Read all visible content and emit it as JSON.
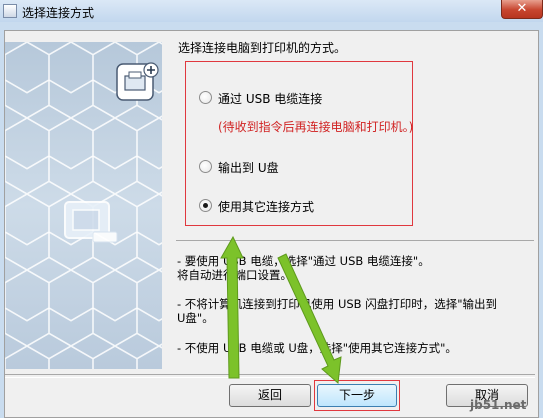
{
  "window": {
    "title": "选择连接方式",
    "close_glyph": "✕"
  },
  "main": {
    "heading": "选择连接电脑到打印机的方式。",
    "options": [
      {
        "label": "通过 USB 电缆连接",
        "checked": false
      },
      {
        "label": "输出到 U盘",
        "checked": false
      },
      {
        "label": "使用其它连接方式",
        "checked": true
      }
    ],
    "note": "(待收到指令后再连接电脑和打印机。)",
    "descriptions": [
      "- 要使用 USB 电缆，选择\"通过 USB 电缆连接\"。",
      "将自动进行端口设置。",
      "- 不将计算机连接到打印机使用 USB 闪盘打印时，选择\"输出到",
      "U盘\"。",
      "- 不使用 USB 电缆或 U盘，选择\"使用其它连接方式\"。"
    ]
  },
  "buttons": {
    "back": "返回",
    "next": "下一步",
    "cancel": "取消"
  },
  "watermark": "jb51.net",
  "colors": {
    "highlight": "#e0383e",
    "arrow": "#7cc22a",
    "note_text": "#d12323"
  },
  "icons": [
    "app-icon",
    "close-icon",
    "printer-add-icon",
    "printer-illustration-icon",
    "green-arrow-icon"
  ]
}
